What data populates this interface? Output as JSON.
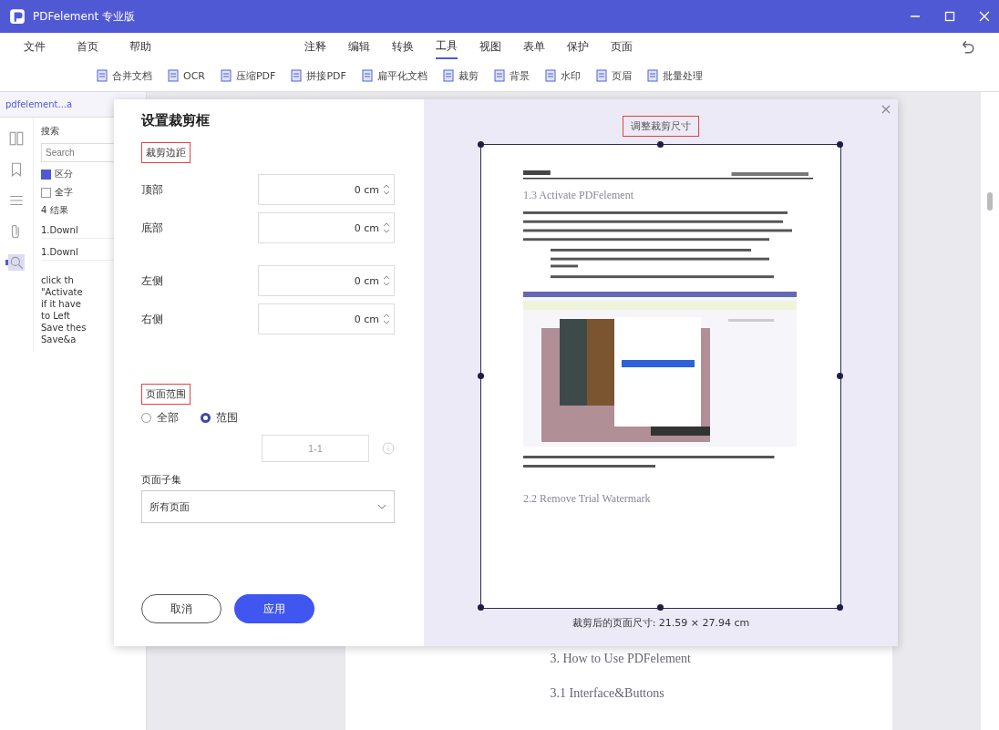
{
  "window": {
    "title": "PDFelement 专业版"
  },
  "menu": [
    "文件",
    "首页",
    "帮助"
  ],
  "tabs": [
    {
      "label": "注释",
      "selected": false
    },
    {
      "label": "编辑",
      "selected": false
    },
    {
      "label": "转换",
      "selected": false
    },
    {
      "label": "工具",
      "selected": true
    },
    {
      "label": "视图",
      "selected": false
    },
    {
      "label": "表单",
      "selected": false
    },
    {
      "label": "保护",
      "selected": false
    },
    {
      "label": "页面",
      "selected": false
    }
  ],
  "tools": [
    {
      "label": "合并文档"
    },
    {
      "label": "OCR"
    },
    {
      "label": "压缩PDF"
    },
    {
      "label": "拼接PDF"
    },
    {
      "label": "扁平化文档"
    },
    {
      "label": "裁剪"
    },
    {
      "label": "背景"
    },
    {
      "label": "水印"
    },
    {
      "label": "页眉"
    },
    {
      "label": "批量处理"
    }
  ],
  "file_tab": {
    "title": "pdfelement...a"
  },
  "search_panel": {
    "title": "搜索",
    "placeholder": "Search",
    "options": [
      {
        "label": "区分",
        "checked": true
      },
      {
        "label": "全字",
        "checked": false
      }
    ],
    "results_header": "4 结果",
    "results": [
      "1.Downl",
      "1.Downl"
    ],
    "snippets": [
      "click th",
      "\"Activate",
      "if it have",
      "to Left",
      "Save thes",
      "Save&a"
    ]
  },
  "dialog": {
    "title": "设置裁剪框",
    "margins_label": "裁剪边距",
    "margins": [
      {
        "label": "顶部",
        "value": "0 cm"
      },
      {
        "label": "底部",
        "value": "0 cm"
      },
      {
        "label": "左侧",
        "value": "0 cm"
      },
      {
        "label": "右侧",
        "value": "0 cm"
      }
    ],
    "range_label": "页面范围",
    "range_options": [
      {
        "label": "全部",
        "selected": false
      },
      {
        "label": "范围",
        "selected": true
      }
    ],
    "range_value": "1-1",
    "subset_label": "页面子集",
    "subset_value": "所有页面",
    "buttons": [
      {
        "label": "取消",
        "kind": "secondary"
      },
      {
        "label": "应用",
        "kind": "primary"
      }
    ],
    "preview_label": "调整裁剪尺寸",
    "size_text": "裁剪后的页面尺寸: 21.59 × 27.94 cm"
  },
  "preview_page": {
    "heading": "1.3 Activate PDFelement",
    "heading_2": "2.2 Remove Trial Watermark"
  },
  "document": {
    "headings": [
      "3. How to Use PDFelement",
      "3.1 Interface&Buttons"
    ]
  }
}
